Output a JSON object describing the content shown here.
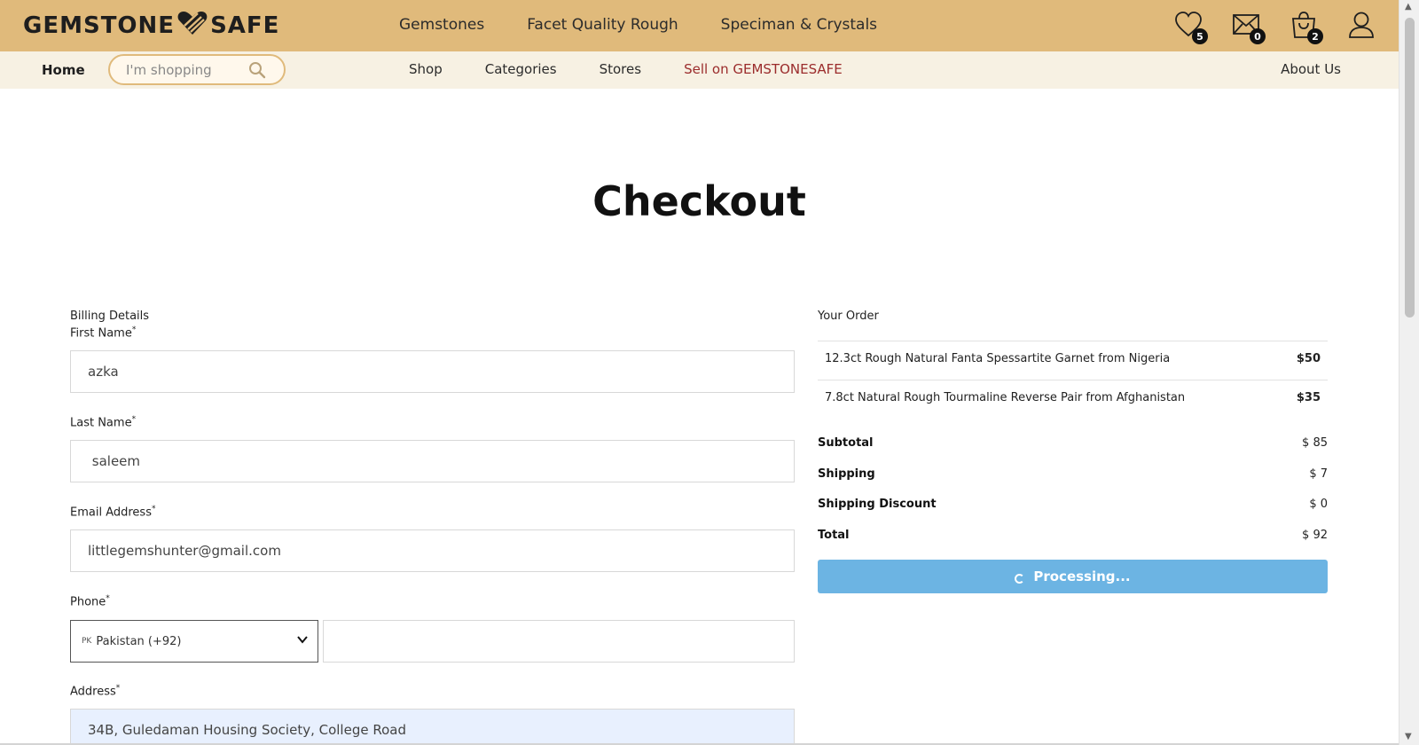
{
  "header": {
    "logo_left": "GEMSTONE",
    "logo_right": "SAFE",
    "nav": [
      "Gemstones",
      "Facet Quality Rough",
      "Speciman & Crystals"
    ],
    "wishlist_count": "5",
    "messages_count": "0",
    "cart_count": "2"
  },
  "subnav": {
    "home": "Home",
    "search_placeholder": "I'm shopping",
    "links": [
      "Shop",
      "Categories",
      "Stores"
    ],
    "sell": "Sell on GEMSTONESAFE",
    "about": "About Us"
  },
  "page_title": "Checkout",
  "billing": {
    "section_title": "Billing Details",
    "first_name_label": "First Name",
    "first_name_value": "azka",
    "last_name_label": "Last Name",
    "last_name_value": " saleem",
    "email_label": "Email Address",
    "email_value": "littlegemshunter@gmail.com",
    "phone_label": "Phone",
    "phone_country_code": "PK",
    "phone_country": "Pakistan (+92)",
    "phone_value": "",
    "address_label": "Address",
    "address_value": "34B, Guledaman Housing Society, College Road",
    "required_mark": "*"
  },
  "order": {
    "title": "Your Order",
    "items": [
      {
        "name": "12.3ct Rough Natural Fanta Spessartite Garnet from Nigeria",
        "price": "$50"
      },
      {
        "name": "7.8ct Natural Rough Tourmaline Reverse Pair from Afghanistan",
        "price": "$35"
      }
    ],
    "subtotal_label": "Subtotal",
    "subtotal_value": "$ 85",
    "shipping_label": "Shipping",
    "shipping_value": "$ 7",
    "discount_label": "Shipping Discount",
    "discount_value": "$ 0",
    "total_label": "Total",
    "total_value": "$ 92",
    "button_label": "Processing..."
  },
  "colors": {
    "header_bg": "#e0ba7b",
    "subnav_bg": "#f7f1e3",
    "sell_link": "#9b2c2c",
    "button_bg": "#6cb4e3"
  }
}
